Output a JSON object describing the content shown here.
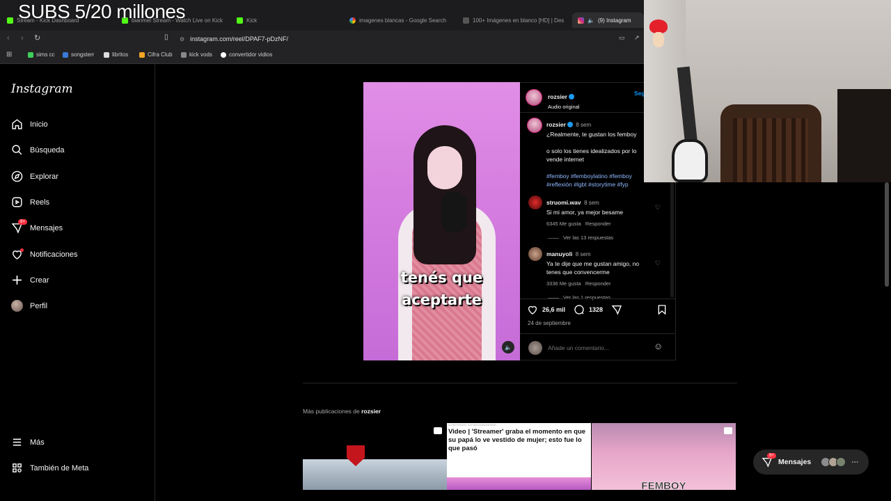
{
  "overlay": {
    "subs_text": "SUBS 5/20 millones"
  },
  "browser": {
    "tabs": [
      {
        "label": "Stream - Kick Dashboard",
        "icon": "kick-icon",
        "active": false
      },
      {
        "label": "bianmel Stream - Watch Live on Kick",
        "icon": "kick-icon",
        "active": false
      },
      {
        "label": "Kick",
        "icon": "kick-icon",
        "active": false
      },
      {
        "label": "imagenes blancas - Google Search",
        "icon": "google-icon",
        "active": false
      },
      {
        "label": "100+ Imágenes en blanco [HD] | Des",
        "icon": "page-icon",
        "active": false
      },
      {
        "label": "(9) Instagram",
        "icon": "instagram-icon",
        "active": true
      }
    ],
    "url": "instagram.com/reel/DPAF7-pDzNF/",
    "bookmarks": [
      "sims cc",
      "songsterr",
      "libritos",
      "Cifra Club",
      "kick vods",
      "convertidor vidios"
    ]
  },
  "sidebar": {
    "logo": "Instagram",
    "items": [
      {
        "label": "Inicio",
        "icon": "home-icon"
      },
      {
        "label": "Búsqueda",
        "icon": "search-icon"
      },
      {
        "label": "Explorar",
        "icon": "compass-icon"
      },
      {
        "label": "Reels",
        "icon": "reels-icon"
      },
      {
        "label": "Mensajes",
        "icon": "messenger-icon",
        "badge": "9+"
      },
      {
        "label": "Notificaciones",
        "icon": "heart-icon"
      },
      {
        "label": "Crear",
        "icon": "plus-icon"
      },
      {
        "label": "Perfil",
        "icon": "avatar"
      }
    ],
    "bottom": [
      {
        "label": "Más",
        "icon": "menu-icon"
      },
      {
        "label": "También de Meta",
        "icon": "meta-icon"
      }
    ]
  },
  "post": {
    "video_caption_line1": "tenés que",
    "video_caption_line2": "aceptarte",
    "author": "rozsier",
    "audio": "Audio original",
    "follow": "Seg",
    "caption_age": "8 sem",
    "caption_line1": "¿Realmente, te gustan los femboy",
    "caption_line2": "o solo los tienes idealizados por lo",
    "caption_line3": "vende internet",
    "hashtags_line1": "#femboy #femboylatino #femboy",
    "hashtags_line2": "#reflexión #lgbt #storytime #fyp",
    "comments": [
      {
        "user": "struomi.wav",
        "age": "8 sem",
        "text": "Si mi amor, ya mejor besame",
        "likes": "6345 Me gusta",
        "reply": "Responder",
        "replies": "Ver las 13 respuestas"
      },
      {
        "user": "manuyoli",
        "age": "8 sem",
        "text": "Ya te dije que me gustan amigo, no tenes que convencerme",
        "likes": "3336 Me gusta",
        "reply": "Responder",
        "replies": "Ver las 1 respuestas"
      }
    ],
    "like_count": "26,6 mil",
    "comment_count": "1328",
    "date": "24 de septiembre",
    "comment_placeholder": "Añade un comentario..."
  },
  "more_posts": {
    "label_prefix": "Más publicaciones de",
    "label_user": "rozsier",
    "article_headline": "Video | 'Streamer' graba el momento en que su papá lo ve vestido de mujer; esto fue lo que pasó",
    "article_source": "CONTENIDO ESTADOUNIDENSE",
    "thumb3_text": "FEMBOY"
  },
  "messages_pill": {
    "label": "Mensajes",
    "badge": "9+"
  }
}
